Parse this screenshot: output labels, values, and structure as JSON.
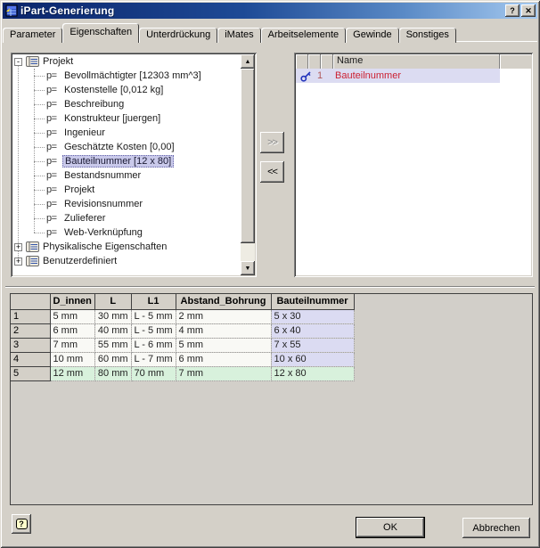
{
  "window": {
    "title": "iPart-Generierung"
  },
  "icons": {
    "help": "?",
    "close": "✕",
    "up_arrow": "▲",
    "down_arrow": "▼",
    "prop": "p="
  },
  "tabs": [
    {
      "label": "Parameter",
      "active": false
    },
    {
      "label": "Eigenschaften",
      "active": true
    },
    {
      "label": "Unterdrückung",
      "active": false
    },
    {
      "label": "iMates",
      "active": false
    },
    {
      "label": "Arbeitselemente",
      "active": false
    },
    {
      "label": "Gewinde",
      "active": false
    },
    {
      "label": "Sonstiges",
      "active": false
    }
  ],
  "tree": {
    "items": [
      {
        "type": "group",
        "expander": "-",
        "label": "Projekt"
      },
      {
        "type": "prop",
        "label": "Bevollmächtigter [12303 mm^3]"
      },
      {
        "type": "prop",
        "label": "Kostenstelle [0,012 kg]"
      },
      {
        "type": "prop",
        "label": "Beschreibung"
      },
      {
        "type": "prop",
        "label": "Konstrukteur [juergen]"
      },
      {
        "type": "prop",
        "label": "Ingenieur"
      },
      {
        "type": "prop",
        "label": "Geschätzte Kosten [0,00]"
      },
      {
        "type": "prop",
        "label": "Bauteilnummer [12 x 80]",
        "selected": true
      },
      {
        "type": "prop",
        "label": "Bestandsnummer"
      },
      {
        "type": "prop",
        "label": "Projekt"
      },
      {
        "type": "prop",
        "label": "Revisionsnummer"
      },
      {
        "type": "prop",
        "label": "Zulieferer"
      },
      {
        "type": "prop",
        "label": "Web-Verknüpfung"
      },
      {
        "type": "group",
        "expander": "+",
        "label": "Physikalische Eigenschaften"
      },
      {
        "type": "group",
        "expander": "+",
        "label": "Benutzerdefiniert"
      }
    ]
  },
  "transfer": {
    "add_label": ">>",
    "remove_label": "<<"
  },
  "selected_list": {
    "name_header": "Name",
    "rows": [
      {
        "index": "1",
        "name": "Bauteilnummer"
      }
    ]
  },
  "grid": {
    "headers": [
      "",
      "D_innen",
      "L",
      "L1",
      "Abstand_Bohrung",
      "Bauteilnummer"
    ],
    "rows": [
      {
        "num": "1",
        "cells": [
          "5 mm",
          "30 mm",
          "L - 5 mm",
          "2 mm",
          "5 x 30"
        ]
      },
      {
        "num": "2",
        "cells": [
          "6 mm",
          "40 mm",
          "L - 5 mm",
          "4 mm",
          "6 x 40"
        ]
      },
      {
        "num": "3",
        "cells": [
          "7 mm",
          "55 mm",
          "L - 6 mm",
          "5 mm",
          "7 x 55"
        ]
      },
      {
        "num": "4",
        "cells": [
          "10 mm",
          "60 mm",
          "L - 7 mm",
          "6 mm",
          "10 x 60"
        ]
      },
      {
        "num": "5",
        "cells": [
          "12 mm",
          "80 mm",
          "70 mm",
          "7 mm",
          "12 x 80"
        ]
      }
    ]
  },
  "footer": {
    "ok_label": "OK",
    "cancel_label": "Abbrechen",
    "help_label": "?"
  },
  "colors": {
    "dialog_bg": "#d4d0c8",
    "titlebar_start": "#0a246a",
    "titlebar_end": "#a6caf0",
    "key_column_lavender": "#dbdbf2",
    "active_row_green": "#d8f1dc",
    "selected_item_lavender": "#c9c9ea",
    "key_name_red": "#cc2233",
    "key_icon_blue": "#2233bb"
  }
}
